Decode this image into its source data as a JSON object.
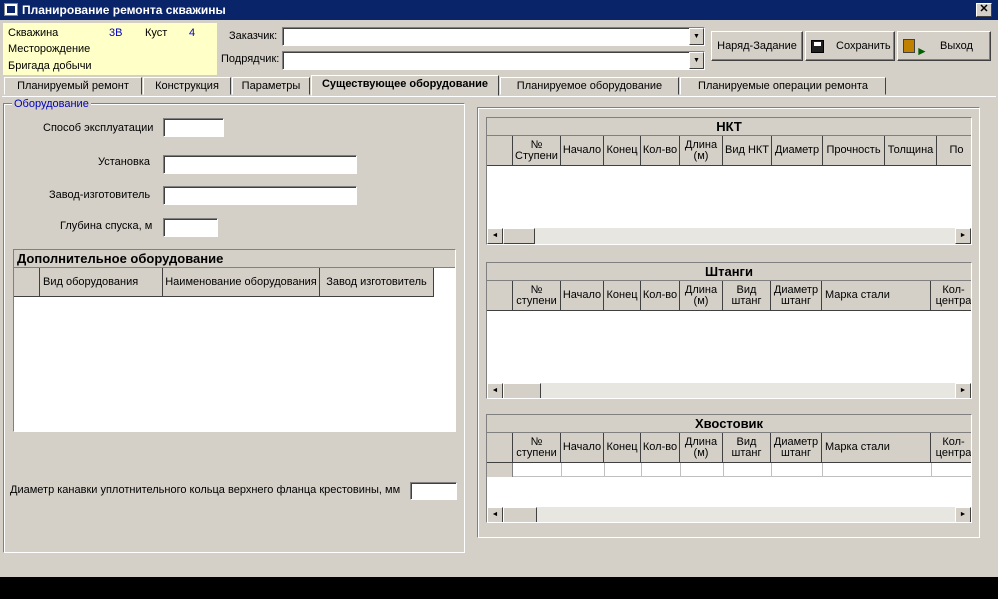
{
  "window": {
    "title": "Планирование ремонта скважины",
    "close": "✕"
  },
  "info": {
    "well_label": "Скважина",
    "well_value": "3В",
    "cluster_label": "Куст",
    "cluster_value": "4",
    "field_label": "Месторождение",
    "brigade_label": "Бригада добычи"
  },
  "form": {
    "customer_label": "Заказчик:",
    "contractor_label": "Подрядчик:"
  },
  "buttons": {
    "order": "Наряд-Задание",
    "save": "Сохранить",
    "exit": "Выход"
  },
  "tabs": [
    "Планируемый ремонт",
    "Конструкция",
    "Параметры",
    "Существующее оборудование",
    "Планируемое оборудование",
    "Планируемые операции ремонта"
  ],
  "equipment": {
    "group_label": "Оборудование",
    "method_label": "Способ эксплуатации",
    "install_label": "Установка",
    "manufacturer_label": "Завод-изготовитель",
    "depth_label": "Глубина спуска, м"
  },
  "additional": {
    "title": "Дополнительное оборудование",
    "columns": [
      "Вид оборудования",
      "Наименование оборудования",
      "Завод изготовитель"
    ]
  },
  "flange_label": "Диаметр канавки уплотнительного кольца верхнего фланца крестовины, мм",
  "nkt": {
    "title": "НКТ",
    "columns": [
      "№ Ступени",
      "Начало",
      "Конец",
      "Кол-во",
      "Длина (м)",
      "Вид НКТ",
      "Диаметр",
      "Прочность",
      "Толщина",
      "По"
    ]
  },
  "rods": {
    "title": "Штанги",
    "columns": [
      "№ ступени",
      "Начало",
      "Конец",
      "Кол-во",
      "Длина (м)",
      "Вид штанг",
      "Диаметр штанг",
      "Марка стали",
      "Кол- центра"
    ]
  },
  "tail": {
    "title": "Хвостовик",
    "columns": [
      "№ ступени",
      "Начало",
      "Конец",
      "Кол-во",
      "Длина (м)",
      "Вид штанг",
      "Диаметр штанг",
      "Марка стали",
      "Кол- центра"
    ]
  }
}
